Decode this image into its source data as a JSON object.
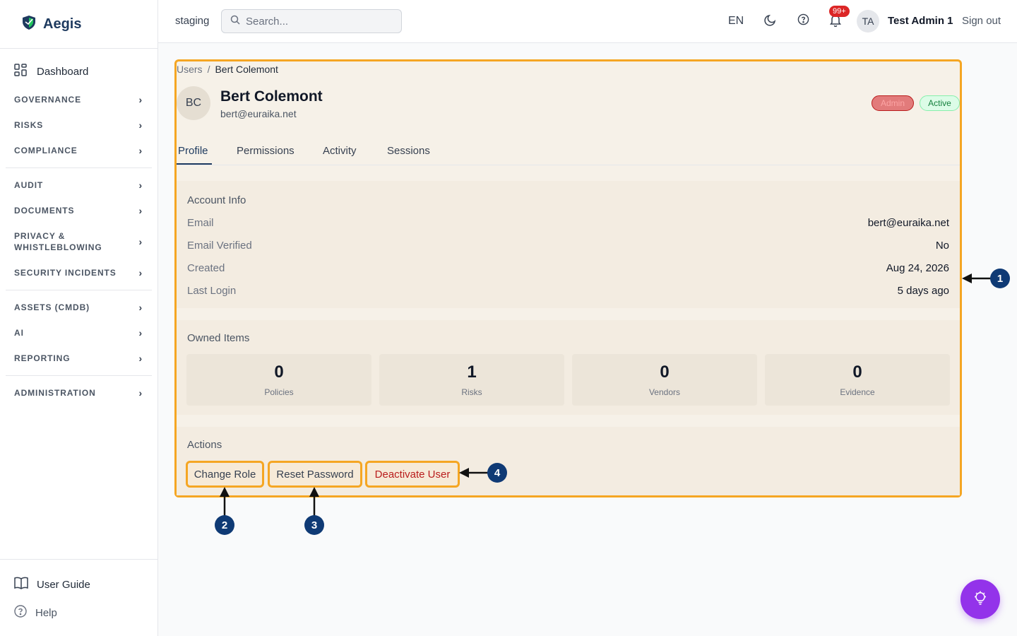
{
  "app": {
    "name": "Aegis"
  },
  "sidebar": {
    "dashboard": "Dashboard",
    "sections": [
      {
        "label": "GOVERNANCE"
      },
      {
        "label": "RISKS"
      },
      {
        "label": "COMPLIANCE"
      },
      {
        "label": "AUDIT"
      },
      {
        "label": "DOCUMENTS"
      },
      {
        "label": "PRIVACY & WHISTLEBLOWING"
      },
      {
        "label": "SECURITY INCIDENTS"
      },
      {
        "label": "ASSETS (CMDB)"
      },
      {
        "label": "AI"
      },
      {
        "label": "REPORTING"
      },
      {
        "label": "ADMINISTRATION"
      }
    ],
    "user_guide": "User Guide",
    "help": "Help"
  },
  "topbar": {
    "environment": "staging",
    "search_placeholder": "Search...",
    "language": "EN",
    "notifications_badge": "99+",
    "avatar_initials": "TA",
    "user_name": "Test Admin 1",
    "sign_out": "Sign out"
  },
  "breadcrumb": {
    "parent": "Users",
    "separator": "/",
    "current": "Bert Colemont"
  },
  "user": {
    "initials": "BC",
    "name": "Bert Colemont",
    "email": "bert@euraika.net",
    "role_badge": "Admin",
    "status_badge": "Active"
  },
  "tabs": [
    {
      "label": "Profile",
      "active": true
    },
    {
      "label": "Permissions"
    },
    {
      "label": "Activity"
    },
    {
      "label": "Sessions"
    }
  ],
  "account_info": {
    "title": "Account Info",
    "rows": [
      {
        "label": "Email",
        "value": "bert@euraika.net"
      },
      {
        "label": "Email Verified",
        "value": "No"
      },
      {
        "label": "Created",
        "value": "Aug 24, 2026"
      },
      {
        "label": "Last Login",
        "value": "5 days ago"
      }
    ]
  },
  "owned_items": {
    "title": "Owned Items",
    "stats": [
      {
        "value": "0",
        "label": "Policies"
      },
      {
        "value": "1",
        "label": "Risks"
      },
      {
        "value": "0",
        "label": "Vendors"
      },
      {
        "value": "0",
        "label": "Evidence"
      }
    ]
  },
  "actions": {
    "title": "Actions",
    "change_role": "Change Role",
    "reset_password": "Reset Password",
    "deactivate_user": "Deactivate User"
  },
  "callouts": [
    "1",
    "2",
    "3",
    "4"
  ],
  "colors": {
    "highlight": "#f5a623",
    "callout": "#0f3a75",
    "brand": "#1e3a5f",
    "danger": "#b91c1c",
    "fab": "#9333ea"
  }
}
